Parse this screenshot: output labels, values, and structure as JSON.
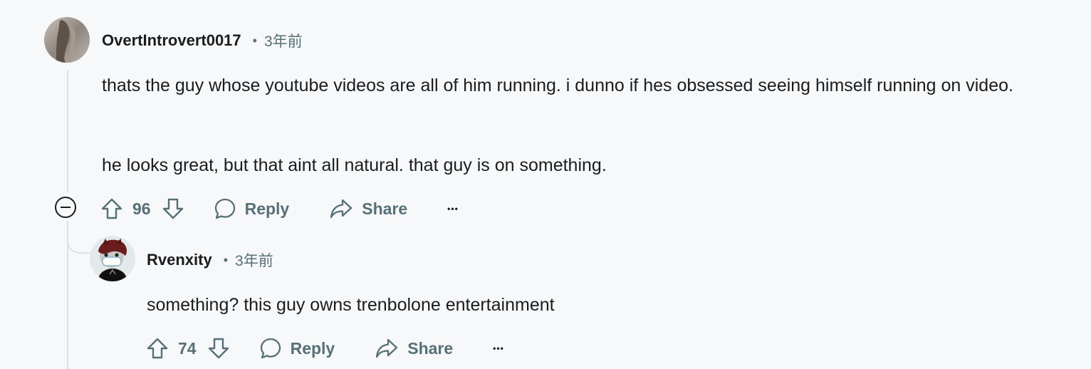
{
  "comments": [
    {
      "username": "OvertIntrovert0017",
      "separator": "•",
      "time": "3年前",
      "paragraphs": [
        "thats the guy whose youtube videos are all of him running. i dunno if hes obsessed seeing himself running on video.",
        "he looks great, but that aint all natural. that guy is on something."
      ],
      "votes": "96",
      "reply_label": "Reply",
      "share_label": "Share",
      "more_label": "•••"
    },
    {
      "username": "Rvenxity",
      "separator": "•",
      "time": "3年前",
      "paragraphs": [
        "something? this guy owns trenbolone entertainment"
      ],
      "votes": "74",
      "reply_label": "Reply",
      "share_label": "Share",
      "more_label": "•••"
    }
  ],
  "icons": {
    "upvote": "upvote-arrow-icon",
    "downvote": "downvote-arrow-icon",
    "reply": "speech-bubble-icon",
    "share": "share-arrow-icon",
    "collapse": "minus-circle-icon"
  },
  "colors": {
    "background": "#f6f8f9",
    "thread_line": "#d7e4e4",
    "meta_gray": "#576f76",
    "text": "#1c1c1c"
  }
}
